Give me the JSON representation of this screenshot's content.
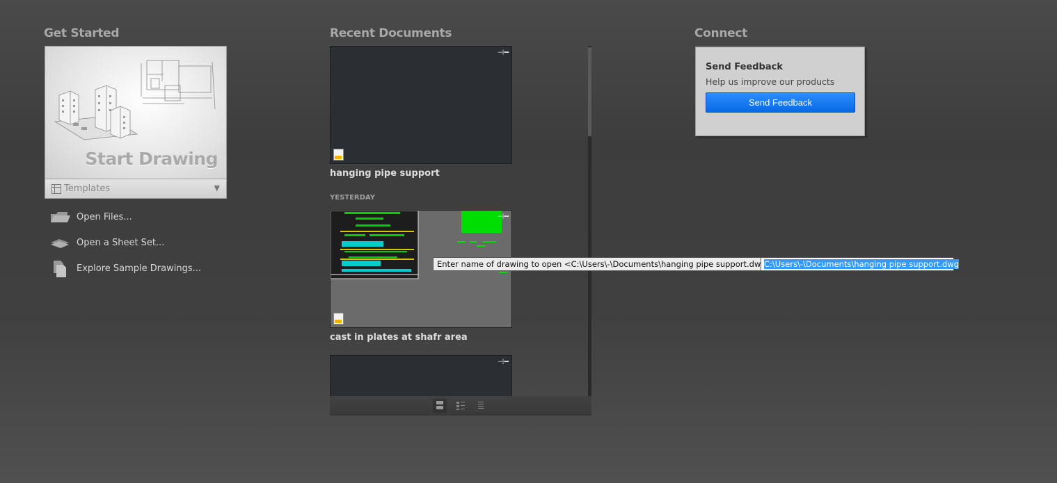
{
  "get_started": {
    "title": "Get Started",
    "start_drawing_label": "Start Drawing",
    "templates_label": "Templates",
    "links": [
      {
        "label": "Open Files...",
        "icon": "open-folder-icon"
      },
      {
        "label": "Open a Sheet Set...",
        "icon": "sheet-set-icon"
      },
      {
        "label": "Explore Sample Drawings...",
        "icon": "sample-drawings-icon"
      }
    ]
  },
  "recent_documents": {
    "title": "Recent Documents",
    "section_yesterday": "YESTERDAY",
    "documents": [
      {
        "name": "hanging pipe support"
      },
      {
        "name": "cast in plates at shafr area"
      },
      {
        "name": ""
      }
    ],
    "view_modes": [
      "large-thumbnails",
      "small-thumbnails-list",
      "list"
    ],
    "active_view": "large-thumbnails"
  },
  "connect": {
    "title": "Connect",
    "feedback_title": "Send Feedback",
    "feedback_subtitle": "Help us improve our products",
    "feedback_button": "Send Feedback",
    "button_color": "#1478f0"
  },
  "command_line": {
    "prompt": "Enter name of drawing to open <C:\\Users\\-\\Documents\\hanging pipe support.dwg>:",
    "input_value": "C:\\Users\\-\\Documents\\hanging pipe support.dwg"
  }
}
